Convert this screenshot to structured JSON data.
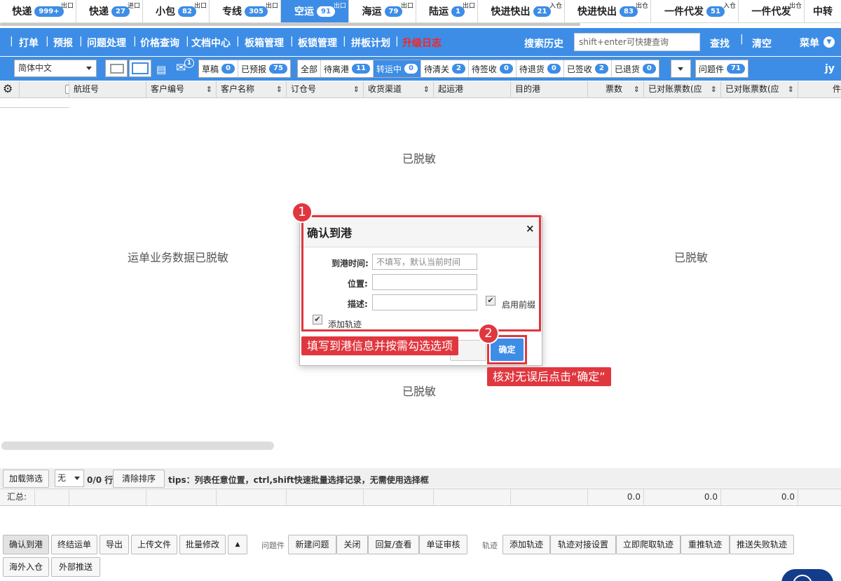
{
  "top_tabs": [
    {
      "label": "快递",
      "badge": "999+",
      "sup": "出口"
    },
    {
      "label": "快递",
      "badge": "27",
      "sup": "进口"
    },
    {
      "label": "小包",
      "badge": "82",
      "sup": "出口"
    },
    {
      "label": "专线",
      "badge": "305",
      "sup": "出口"
    },
    {
      "label": "空运",
      "badge": "91",
      "sup": "出口",
      "active": true
    },
    {
      "label": "海运",
      "badge": "79",
      "sup": "出口"
    },
    {
      "label": "陆运",
      "badge": "1",
      "sup": "出口"
    },
    {
      "label": "快进快出",
      "badge": "21",
      "sup": "入仓"
    },
    {
      "label": "快进快出",
      "badge": "83",
      "sup": "出仓"
    },
    {
      "label": "一件代发",
      "badge": "51",
      "sup": "入仓"
    },
    {
      "label": "一件代发",
      "badge": "",
      "sup": "出仓"
    },
    {
      "label": "中转",
      "badge": "",
      "sup": ""
    }
  ],
  "menu": {
    "items": [
      "打单",
      "预报",
      "问题处理",
      "价格查询",
      "文档中心",
      "板箱管理",
      "板锁管理",
      "拼板计划"
    ],
    "upgrade": "升级日志",
    "search_history": "搜索历史",
    "search_placeholder": "shift+enter可快捷查询",
    "search_btn": "查找",
    "clear_btn": "清空",
    "menu_btn": "菜单"
  },
  "toolbar": {
    "language": "简体中文",
    "mail_badge": "1",
    "group1": [
      {
        "label": "草稿",
        "badge": "0"
      },
      {
        "label": "已预报",
        "badge": "75"
      }
    ],
    "group2": [
      {
        "label": "全部",
        "badge": ""
      },
      {
        "label": "待离港",
        "badge": "11"
      },
      {
        "label": "转运中",
        "badge": "0",
        "active": true
      },
      {
        "label": "待清关",
        "badge": "2"
      },
      {
        "label": "待签收",
        "badge": "0"
      },
      {
        "label": "待退货",
        "badge": "0"
      },
      {
        "label": "已签收",
        "badge": "2"
      },
      {
        "label": "已退货",
        "badge": "0"
      }
    ],
    "group3": [
      {
        "label": "问题件",
        "badge": "71"
      }
    ],
    "user": "jy"
  },
  "grid": {
    "columns": [
      "航班号",
      "客户编号",
      "客户名称",
      "订仓号",
      "收货渠道",
      "起运港",
      "目的港",
      "票数",
      "已对账票数(应",
      "已对账票数(应",
      "件"
    ]
  },
  "masked": {
    "top": "已脱敏",
    "left": "运单业务数据已脱敏",
    "right": "已脱敏",
    "bottom": "已脱敏"
  },
  "dialog": {
    "title": "确认到港",
    "close": "×",
    "time_label": "到港时间:",
    "time_placeholder": "不填写，默认当前时间",
    "location_label": "位置:",
    "desc_label": "描述:",
    "prefix_checkbox": "启用前缀",
    "track_checkbox": "添加轨迹",
    "confirm": "确定"
  },
  "annotations": {
    "step1": "1",
    "step2": "2",
    "callout1": "填写到港信息并按需勾选选项",
    "callout2": "核对无误后点击“确定”"
  },
  "footer": {
    "load_filter": "加载筛选",
    "filter_value": "无",
    "row_count": "0/0 行",
    "clear_sort": "清除排序",
    "tips": "tips：列表任意位置，ctrl,shift快速批量选择记录，无需使用选择框",
    "summary_label": "汇总:",
    "summary_values": [
      "0.0",
      "0.0",
      "0.0"
    ],
    "actions": [
      "确认到港",
      "终结运单",
      "导出",
      "上传文件",
      "批量修改"
    ],
    "problem_label": "问题件",
    "problem_actions": [
      "新建问题",
      "关闭",
      "回复/查看",
      "单证审核"
    ],
    "track_label": "轨迹",
    "track_actions": [
      "添加轨迹",
      "轨迹对接设置",
      "立即爬取轨迹",
      "重推轨迹",
      "推送失败轨迹"
    ],
    "row2_actions": [
      "海外入仓",
      "外部推送"
    ]
  },
  "colors": {
    "accent": "#3d8de6",
    "annotation": "#e0373f"
  }
}
